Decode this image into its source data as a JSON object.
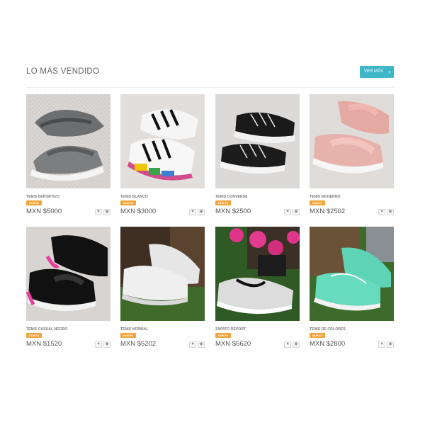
{
  "section": {
    "title": "LO MÁS VENDIDO",
    "see_more_label": "VER MÁS",
    "see_more_icon": "chevron-right-icon"
  },
  "products": [
    {
      "name": "TENIS DEPORTIVO",
      "badge": "NUEVO",
      "price": "MXN $5000"
    },
    {
      "name": "TENIS BLANCO",
      "badge": "NUEVO",
      "price": "MXN $3000"
    },
    {
      "name": "TENIS CONVERSE",
      "badge": "NUEVO",
      "price": "MXN $2500"
    },
    {
      "name": "TENIS MODERNO",
      "badge": "NUEVO",
      "price": "MXN $2502"
    },
    {
      "name": "TENIS CASUAL NEGRO",
      "badge": "NUEVO",
      "price": "MXN $1520"
    },
    {
      "name": "TENIS NORMAL",
      "badge": "NUEVO",
      "price": "MXN $5202"
    },
    {
      "name": "ZAPATO DEPORT",
      "badge": "NUEVO",
      "price": "MXN $5620"
    },
    {
      "name": "TENIS DE COLORES",
      "badge": "NUEVO",
      "price": "MXN $2800"
    }
  ],
  "icons": {
    "wishlist": "heart-icon",
    "quickview": "eye-icon"
  },
  "colors": {
    "accent": "#3fb7c9",
    "badge": "#f2a33a"
  }
}
